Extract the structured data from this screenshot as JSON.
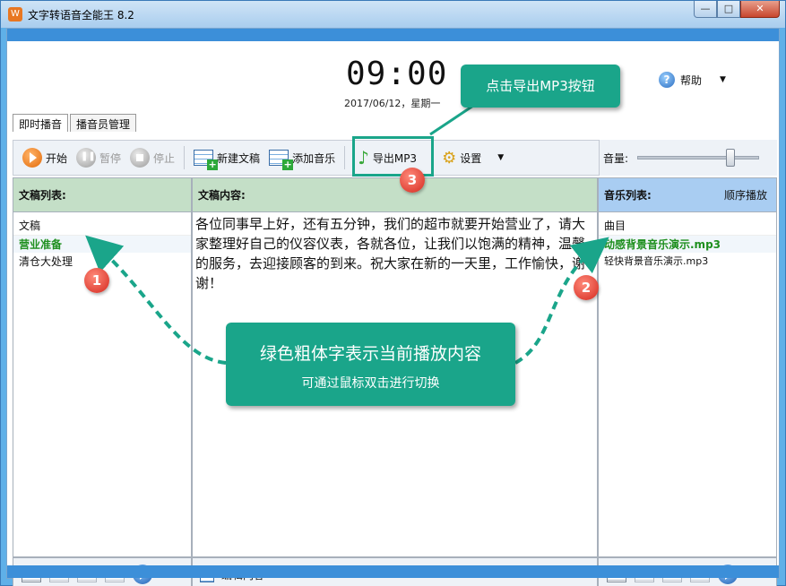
{
  "window": {
    "title": "文字转语音全能王 8.2",
    "controls": {
      "minimize": "—",
      "maximize": "□",
      "close": "✕"
    }
  },
  "clock": {
    "time": "09:00",
    "date": "2017/06/12，星期一"
  },
  "help": {
    "label": "帮助",
    "arrow": "▼"
  },
  "tabs": [
    {
      "label": "即时播音"
    },
    {
      "label": "播音员管理"
    }
  ],
  "toolbar": {
    "start": "开始",
    "pause": "暂停",
    "stop": "停止",
    "new_doc": "新建文稿",
    "add_music": "添加音乐",
    "export_mp3": "导出MP3",
    "settings": "设置",
    "settings_arrow": "▼"
  },
  "volume": {
    "label": "音量:",
    "level": 0.78
  },
  "left_panel": {
    "title": "文稿列表:",
    "column_header": "文稿",
    "items": [
      "营业准备",
      "清仓大处理"
    ],
    "current_index": 0
  },
  "mid_panel": {
    "title": "文稿内容:",
    "text": "各位同事早上好，还有五分钟，我们的超市就要开始营业了，请大家整理好自己的仪容仪表，各就各位，让我们以饱满的精神，温馨的服务，去迎接顾客的到来。祝大家在新的一天里，工作愉快，谢谢！",
    "footer": "编辑内容"
  },
  "right_panel": {
    "title": "音乐列表:",
    "mode": "顺序播放",
    "column_header": "曲目",
    "items": [
      "动感背景音乐演示.mp3",
      "轻快背景音乐演示.mp3"
    ],
    "current_index": 0
  },
  "annotations": {
    "export_callout": "点击导出MP3按钮",
    "main_line1": "绿色粗体字表示当前播放内容",
    "main_line2": "可通过鼠标双击进行切换",
    "badge1": "1",
    "badge2": "2",
    "badge3": "3",
    "accent_color": "#1aa58a",
    "badge_color": "#d4281e"
  }
}
